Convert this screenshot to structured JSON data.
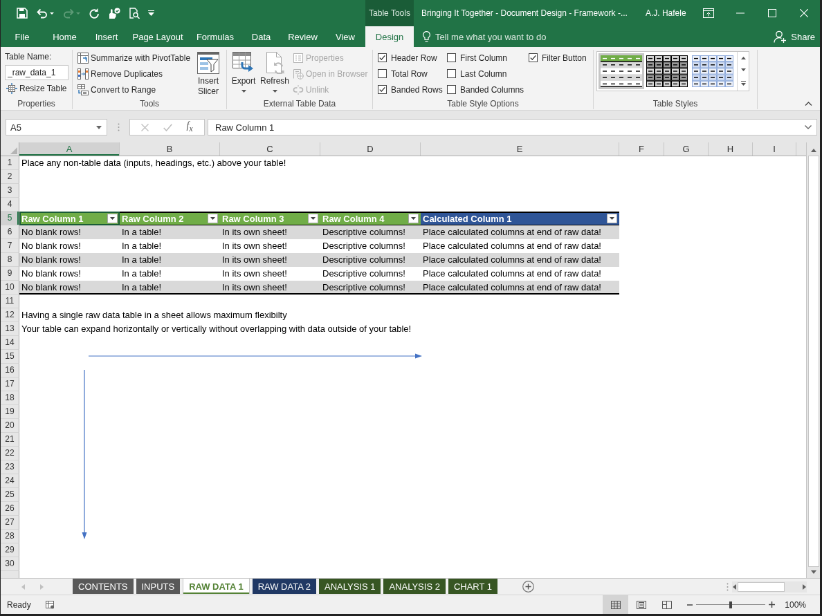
{
  "window": {
    "context_label": "Table Tools",
    "title": "Bringing It Together - Document Design - Framework -...",
    "user": "A.J. Hafele"
  },
  "quick_access": [
    {
      "kind": "save",
      "disabled": false
    },
    {
      "kind": "undo",
      "disabled": false
    },
    {
      "kind": "redo",
      "disabled": true
    },
    {
      "kind": "repeat",
      "disabled": false
    },
    {
      "kind": "touch",
      "disabled": false
    },
    {
      "kind": "preview",
      "disabled": false
    },
    {
      "kind": "customize",
      "disabled": false
    }
  ],
  "menu_tabs": [
    {
      "label": "File",
      "selected": false
    },
    {
      "label": "Home",
      "selected": false
    },
    {
      "label": "Insert",
      "selected": false
    },
    {
      "label": "Page Layout",
      "selected": false
    },
    {
      "label": "Formulas",
      "selected": false
    },
    {
      "label": "Data",
      "selected": false
    },
    {
      "label": "Review",
      "selected": false
    },
    {
      "label": "View",
      "selected": false
    },
    {
      "label": "Design",
      "selected": true
    }
  ],
  "tell_me": {
    "placeholder": "Tell me what you want to do"
  },
  "share": "Share",
  "ribbon": {
    "properties": {
      "label": "Properties",
      "name_label": "Table Name:",
      "name_value": "_raw_data_1",
      "resize": "Resize Table"
    },
    "tools": {
      "label": "Tools",
      "commands": [
        {
          "kind": "pivot",
          "label": "Summarize with PivotTable"
        },
        {
          "kind": "duplicates",
          "label": "Remove Duplicates"
        },
        {
          "kind": "convert",
          "label": "Convert to Range"
        }
      ],
      "slicer": "Insert Slicer"
    },
    "external": {
      "label": "External Table Data",
      "large": [
        {
          "kind": "export",
          "label": "Export"
        },
        {
          "kind": "refresh",
          "label": "Refresh"
        }
      ],
      "commands": [
        {
          "kind": "properties",
          "label": "Properties",
          "disabled": true
        },
        {
          "kind": "browser",
          "label": "Open in Browser",
          "disabled": true
        },
        {
          "kind": "unlink",
          "label": "Unlink",
          "disabled": true
        }
      ]
    },
    "style_options": {
      "label": "Table Style Options",
      "options": [
        {
          "label": "Header Row",
          "checked": true
        },
        {
          "label": "Total Row",
          "checked": false
        },
        {
          "label": "Banded Rows",
          "checked": true
        },
        {
          "label": "First Column",
          "checked": false
        },
        {
          "label": "Last Column",
          "checked": false
        },
        {
          "label": "Banded Columns",
          "checked": false
        },
        {
          "label": "Filter Button",
          "checked": true
        }
      ]
    },
    "table_styles": {
      "label": "Table Styles",
      "styles": [
        {
          "kind": "header",
          "color": "#70ad47",
          "selected": true
        },
        {
          "kind": "grid",
          "color": "#000000",
          "selected": false
        },
        {
          "kind": "grid",
          "color": "#8eaadb",
          "selected": false
        }
      ]
    }
  },
  "formula_bar": {
    "name_box": "A5",
    "function_label": "f$_{x}$",
    "value": "Raw Column 1"
  },
  "sheet": {
    "columns": [
      {
        "label": "A",
        "selected": true
      },
      {
        "label": "B",
        "selected": false
      },
      {
        "label": "C",
        "selected": false
      },
      {
        "label": "D",
        "selected": false
      },
      {
        "label": "E",
        "selected": false
      },
      {
        "label": "F",
        "selected": false
      },
      {
        "label": "G",
        "selected": false
      },
      {
        "label": "H",
        "selected": false
      },
      {
        "label": "I",
        "selected": false
      }
    ],
    "table": {
      "headers": [
        {
          "label": "Raw Column 1",
          "color": "#70ad47"
        },
        {
          "label": "Raw Column 2",
          "color": "#70ad47"
        },
        {
          "label": "Raw Column 3",
          "color": "#70ad47"
        },
        {
          "label": "Raw Column 4",
          "color": "#70ad47"
        },
        {
          "label": "Calculated Column 1",
          "color": "#2f5597"
        }
      ]
    },
    "rows": [
      {
        "label": "1",
        "selected": false,
        "kind": "text",
        "text": "Place any non-table data (inputs, headings, etc.) above your table!"
      },
      {
        "label": "2",
        "selected": false,
        "kind": "empty"
      },
      {
        "label": "3",
        "selected": false,
        "kind": "empty"
      },
      {
        "label": "4",
        "selected": false,
        "kind": "empty"
      },
      {
        "label": "5",
        "selected": true,
        "kind": "table-header"
      },
      {
        "label": "6",
        "selected": false,
        "kind": "table-data",
        "cells": [
          "No blank rows!",
          "In a table!",
          "In its own sheet!",
          "Descriptive columns!",
          "Place calculated columns at end of raw data!"
        ]
      },
      {
        "label": "7",
        "selected": false,
        "kind": "table-data",
        "cells": [
          "No blank rows!",
          "In a table!",
          "In its own sheet!",
          "Descriptive columns!",
          "Place calculated columns at end of raw data!"
        ]
      },
      {
        "label": "8",
        "selected": false,
        "kind": "table-data",
        "cells": [
          "No blank rows!",
          "In a table!",
          "In its own sheet!",
          "Descriptive columns!",
          "Place calculated columns at end of raw data!"
        ]
      },
      {
        "label": "9",
        "selected": false,
        "kind": "table-data",
        "cells": [
          "No blank rows!",
          "In a table!",
          "In its own sheet!",
          "Descriptive columns!",
          "Place calculated columns at end of raw data!"
        ]
      },
      {
        "label": "10",
        "selected": false,
        "kind": "table-data",
        "cells": [
          "No blank rows!",
          "In a table!",
          "In its own sheet!",
          "Descriptive columns!",
          "Place calculated columns at end of raw data!"
        ]
      },
      {
        "label": "11",
        "selected": false,
        "kind": "empty"
      },
      {
        "label": "12",
        "selected": false,
        "kind": "text",
        "text": "Having a single raw data table in a sheet allows maximum flexibilty"
      },
      {
        "label": "13",
        "selected": false,
        "kind": "text",
        "text": "Your table can expand horizontally or vertically without overlapping with data outside of your table!"
      },
      {
        "label": "14",
        "selected": false,
        "kind": "empty"
      },
      {
        "label": "15",
        "selected": false,
        "kind": "empty"
      },
      {
        "label": "16",
        "selected": false,
        "kind": "empty"
      },
      {
        "label": "17",
        "selected": false,
        "kind": "empty"
      },
      {
        "label": "18",
        "selected": false,
        "kind": "empty"
      },
      {
        "label": "19",
        "selected": false,
        "kind": "empty"
      },
      {
        "label": "20",
        "selected": false,
        "kind": "empty"
      },
      {
        "label": "21",
        "selected": false,
        "kind": "empty"
      },
      {
        "label": "22",
        "selected": false,
        "kind": "empty"
      },
      {
        "label": "23",
        "selected": false,
        "kind": "empty"
      },
      {
        "label": "24",
        "selected": false,
        "kind": "empty"
      },
      {
        "label": "25",
        "selected": false,
        "kind": "empty"
      },
      {
        "label": "26",
        "selected": false,
        "kind": "empty"
      },
      {
        "label": "27",
        "selected": false,
        "kind": "empty"
      },
      {
        "label": "28",
        "selected": false,
        "kind": "empty"
      },
      {
        "label": "29",
        "selected": false,
        "kind": "empty"
      },
      {
        "label": "30",
        "selected": false,
        "kind": "empty"
      }
    ]
  },
  "sheet_tabs": [
    {
      "label": "CONTENTS",
      "selected": false,
      "color": "#595959"
    },
    {
      "label": "INPUTS",
      "selected": false,
      "color": "#595959"
    },
    {
      "label": "RAW DATA 1",
      "selected": true,
      "color": "#548235"
    },
    {
      "label": "RAW DATA 2",
      "selected": false,
      "color": "#203864"
    },
    {
      "label": "ANALYSIS 1",
      "selected": false,
      "color": "#375623"
    },
    {
      "label": "ANALYSIS 2",
      "selected": false,
      "color": "#375623"
    },
    {
      "label": "CHART 1",
      "selected": false,
      "color": "#375623"
    }
  ],
  "status_bar": {
    "status": "Ready",
    "views": [
      {
        "kind": "normal",
        "selected": true
      },
      {
        "kind": "page-layout",
        "selected": false
      },
      {
        "kind": "page-break",
        "selected": false
      }
    ],
    "zoom": {
      "level": 0.5,
      "reading": "100%"
    }
  }
}
